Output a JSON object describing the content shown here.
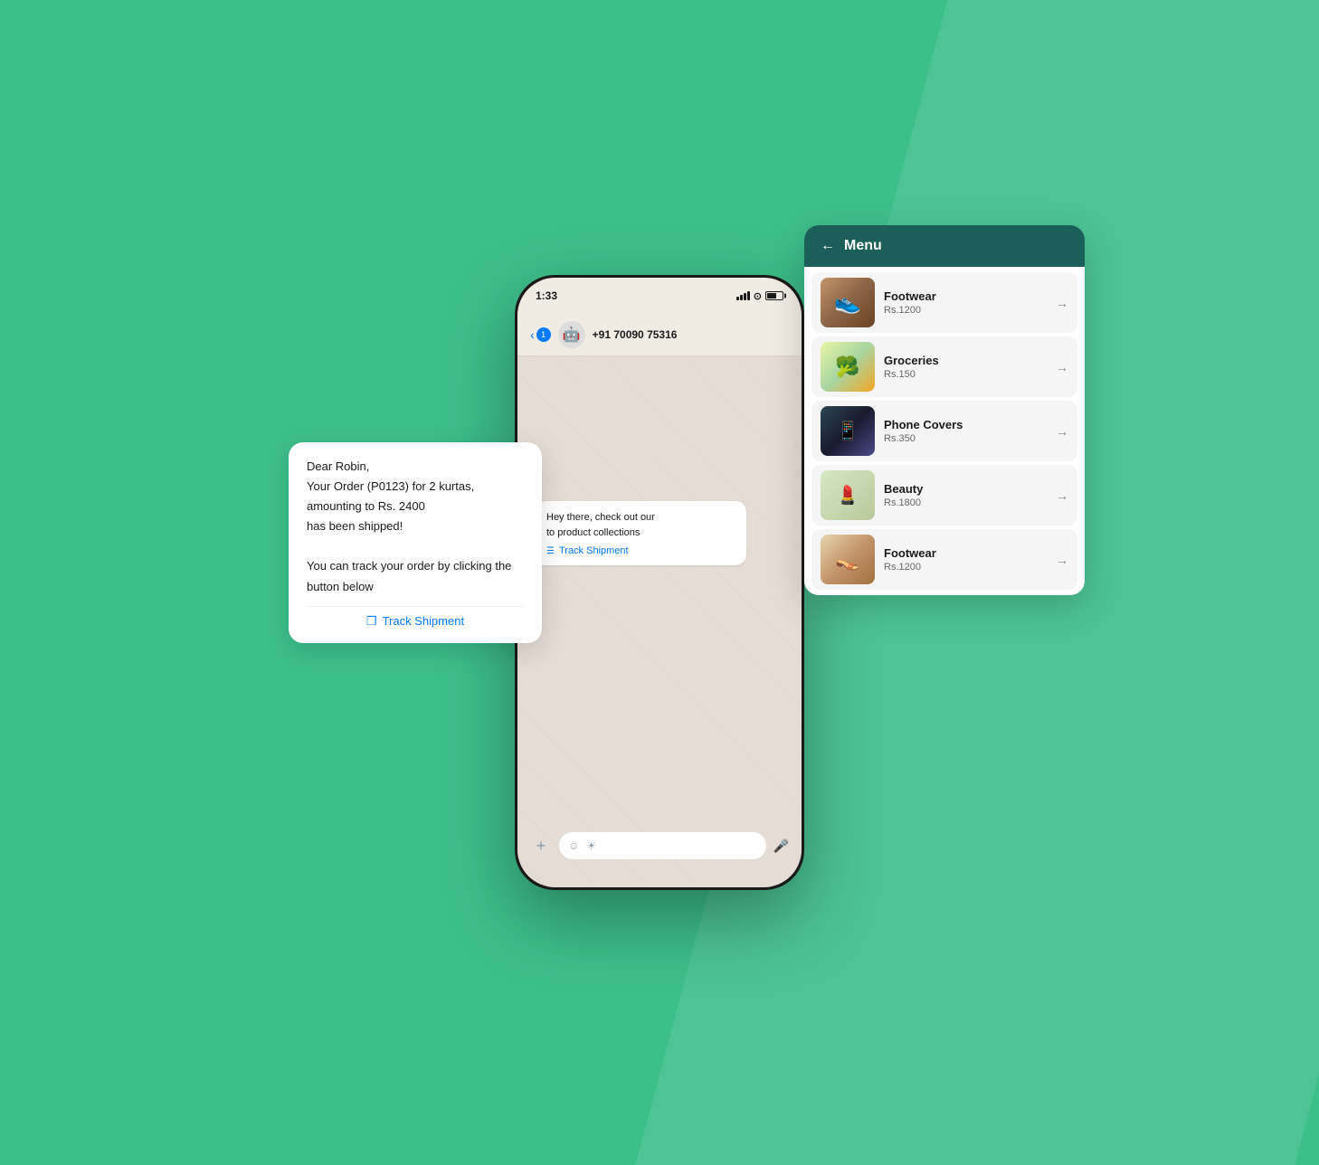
{
  "background": {
    "color": "#3dbf8a"
  },
  "status_bar": {
    "time": "1:33",
    "signal": "signal",
    "wifi": "wifi",
    "battery": "battery"
  },
  "chat_header": {
    "back_label": "1",
    "contact": "+91 70090 75316"
  },
  "top_bubble": {
    "text": "Hey there, check out our\nto product collections",
    "link_label": "Track Shipment"
  },
  "left_bubble": {
    "line1": "Dear Robin,",
    "line2": "Your Order (P0123) for 2 kurtas,",
    "line3": "amounting to Rs. 2400",
    "line4": "has been shipped!",
    "line5": "",
    "line6": "You can track your order by clicking the",
    "line7": "button below",
    "link_label": "Track Shipment"
  },
  "menu": {
    "title": "Menu",
    "back_label": "←",
    "items": [
      {
        "name": "Footwear",
        "price": "Rs.1200",
        "img": "shoes"
      },
      {
        "name": "Groceries",
        "price": "Rs.150",
        "img": "groceries"
      },
      {
        "name": "Phone Covers",
        "price": "Rs.350",
        "img": "phone"
      },
      {
        "name": "Beauty",
        "price": "Rs.1800",
        "img": "beauty"
      },
      {
        "name": "Footwear",
        "price": "Rs.1200",
        "img": "footwear2"
      }
    ]
  },
  "chat_bottom": {
    "plus_label": "+",
    "mic_label": "🎤"
  },
  "colors": {
    "accent_green": "#3dbf8a",
    "menu_header": "#1a5f5a",
    "link_blue": "#007aff",
    "bubble_bg": "#ffffff"
  }
}
